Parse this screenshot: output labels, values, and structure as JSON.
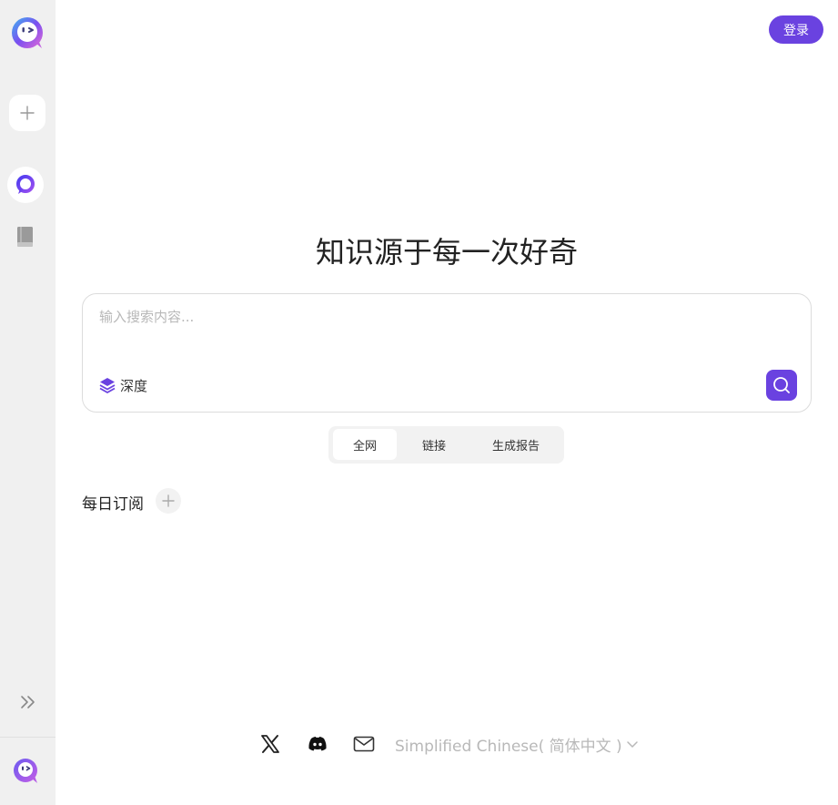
{
  "header": {
    "login_label": "登录"
  },
  "hero": {
    "title": "知识源于每一次好奇"
  },
  "search": {
    "placeholder": "输入搜索内容...",
    "deep_label": "深度"
  },
  "tabs": [
    {
      "label": "全网",
      "active": true
    },
    {
      "label": "链接",
      "active": false
    },
    {
      "label": "生成报告",
      "active": false
    }
  ],
  "daily": {
    "title": "每日订阅"
  },
  "footer": {
    "language": "Simplified Chinese( 简体中文 )",
    "icons": [
      "x-icon",
      "discord-icon",
      "mail-icon"
    ]
  },
  "colors": {
    "accent": "#6a42e0",
    "sidebar_bg": "#f0f0f0"
  }
}
